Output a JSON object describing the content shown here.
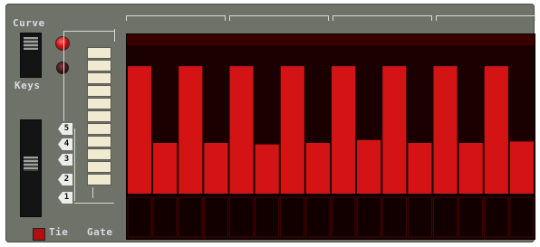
{
  "labels": {
    "curve": "Curve",
    "keys": "Keys",
    "tie": "Tie",
    "gate": "Gate"
  },
  "octaves": [
    "5",
    "4",
    "3",
    "2",
    "1"
  ],
  "steps": [
    {
      "value": 0.88,
      "note": "high"
    },
    {
      "value": 0.35,
      "note": "low"
    },
    {
      "value": 0.88,
      "note": "high"
    },
    {
      "value": 0.35,
      "note": "low"
    },
    {
      "value": 0.88,
      "note": "high"
    },
    {
      "value": 0.34,
      "note": "low"
    },
    {
      "value": 0.88,
      "note": "high"
    },
    {
      "value": 0.35,
      "note": "low"
    },
    {
      "value": 0.88,
      "note": "high"
    },
    {
      "value": 0.37,
      "note": "low"
    },
    {
      "value": 0.88,
      "note": "high"
    },
    {
      "value": 0.35,
      "note": "low"
    },
    {
      "value": 0.88,
      "note": "high"
    },
    {
      "value": 0.35,
      "note": "low"
    },
    {
      "value": 0.88,
      "note": "high"
    },
    {
      "value": 0.36,
      "note": "low"
    }
  ],
  "colors": {
    "bar": "#d41414",
    "background": "#1b0000",
    "panel": "#6e7268"
  }
}
